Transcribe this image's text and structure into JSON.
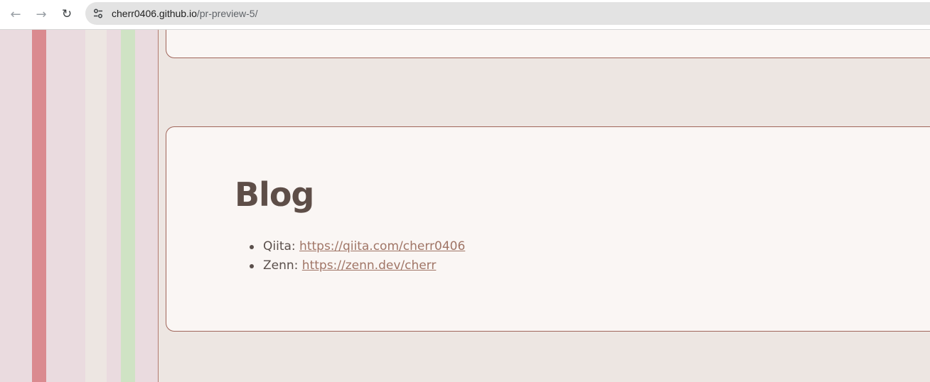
{
  "browser": {
    "url_host": "cherr0406.github.io",
    "url_path": "/pr-preview-5/",
    "icons": {
      "back": "back-arrow-icon",
      "forward": "forward-arrow-icon",
      "reload": "reload-icon",
      "site_info": "tune-icon"
    }
  },
  "blog": {
    "title": "Blog",
    "items": [
      {
        "label": "Qiita: ",
        "link": "https://qiita.com/cherr0406"
      },
      {
        "label": "Zenn: ",
        "link": "https://zenn.dev/cherr"
      }
    ]
  },
  "colors": {
    "background": "#ede6e2",
    "card": "#faf6f4",
    "card_border": "#a0655a",
    "heading": "#5e4e48",
    "link": "#a07566",
    "sidebar": "#eadbdf",
    "stripe_red": "#da8a8f",
    "stripe_green": "#cfe3c4"
  }
}
